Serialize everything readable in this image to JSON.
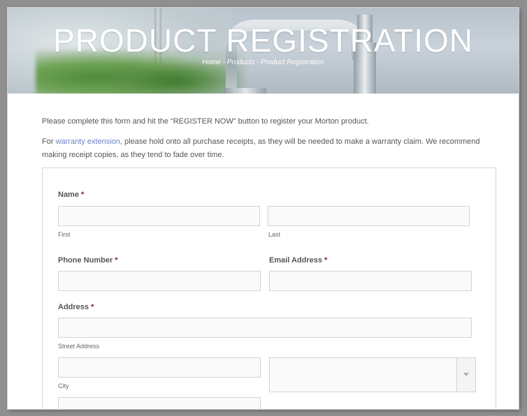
{
  "hero": {
    "title": "PRODUCT REGISTRATION",
    "breadcrumb": [
      "Home",
      "Products",
      "Product Registration"
    ],
    "breadcrumb_separator": " - "
  },
  "intro": {
    "line1": "Please complete this form and hit the “REGISTER NOW” button to register your Morton product.",
    "line2_prefix": "For ",
    "line2_link": "warranty extension",
    "line2_suffix": ", please hold onto all purchase receipts, as they will be needed to make a warranty claim. We recommend making receipt copies, as they tend to fade over time."
  },
  "form": {
    "required_marker": "*",
    "name": {
      "label": "Name",
      "first_sub": "First",
      "last_sub": "Last",
      "first_value": "",
      "last_value": ""
    },
    "phone": {
      "label": "Phone Number",
      "value": ""
    },
    "email": {
      "label": "Email Address",
      "value": ""
    },
    "address": {
      "label": "Address",
      "street_sub": "Street Address",
      "city_sub": "City",
      "street_value": "",
      "city_value": "",
      "state_value": ""
    }
  },
  "colors": {
    "link": "#6d7fc6",
    "required": "#8b1a1a",
    "text": "#555555"
  }
}
